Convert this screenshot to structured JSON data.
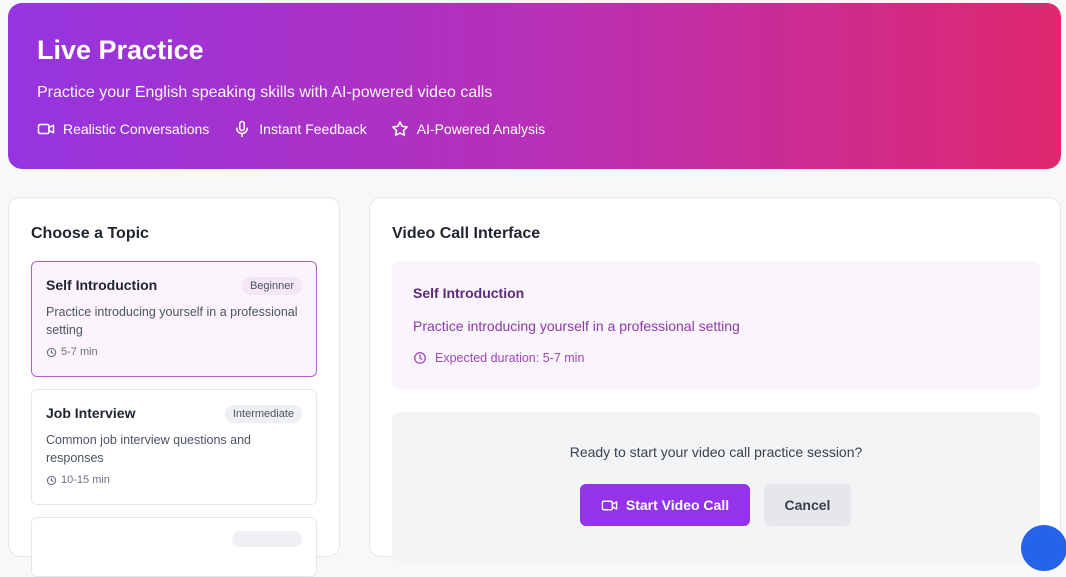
{
  "hero": {
    "title": "Live Practice",
    "subtitle": "Practice your English speaking skills with AI-powered video calls",
    "features": [
      {
        "icon": "video-icon",
        "label": "Realistic Conversations"
      },
      {
        "icon": "microphone-icon",
        "label": "Instant Feedback"
      },
      {
        "icon": "star-icon",
        "label": "AI-Powered Analysis"
      }
    ]
  },
  "topics": {
    "heading": "Choose a Topic",
    "items": [
      {
        "name": "Self Introduction",
        "level": "Beginner",
        "desc": "Practice introducing yourself in a professional setting",
        "duration": "5-7 min"
      },
      {
        "name": "Job Interview",
        "level": "Intermediate",
        "desc": "Common job interview questions and responses",
        "duration": "10-15 min"
      }
    ]
  },
  "video": {
    "heading": "Video Call Interface",
    "selected_title": "Self Introduction",
    "selected_desc": "Practice introducing yourself in a professional setting",
    "expected_duration": "Expected duration: 5-7 min",
    "prompt": "Ready to start your video call practice session?",
    "start_label": "Start Video Call",
    "cancel_label": "Cancel"
  },
  "colors": {
    "accent": "#9333ea",
    "gradient_start": "#9534e0",
    "gradient_end": "#e0286f",
    "fab": "#2563eb"
  }
}
